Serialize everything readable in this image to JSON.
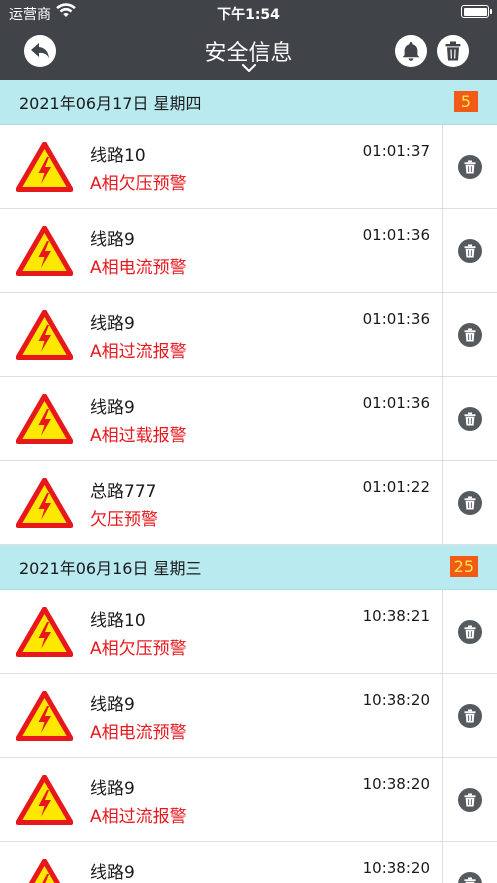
{
  "status_bar": {
    "carrier": "运营商",
    "time": "下午1:54"
  },
  "nav": {
    "title": "安全信息"
  },
  "icons": {
    "back": "back-arrow-icon",
    "bell": "bell-icon",
    "trash": "trash-icon",
    "warning": "high-voltage-warning-icon",
    "row_delete": "trash-icon"
  },
  "colors": {
    "nav_bg": "#404448",
    "day_header_bg": "#b9eaf0",
    "badge_bg": "#f25a18",
    "badge_text": "#ffe84a",
    "alarm_text": "#e8171c"
  },
  "days": [
    {
      "date": "2021年06月17日 星期四",
      "count": "5",
      "items": [
        {
          "line": "线路10",
          "alarm": "A相欠压预警",
          "time": "01:01:37"
        },
        {
          "line": "线路9",
          "alarm": "A相电流预警",
          "time": "01:01:36"
        },
        {
          "line": "线路9",
          "alarm": "A相过流报警",
          "time": "01:01:36"
        },
        {
          "line": "线路9",
          "alarm": "A相过载报警",
          "time": "01:01:36"
        },
        {
          "line": "总路777",
          "alarm": "欠压预警",
          "time": "01:01:22"
        }
      ]
    },
    {
      "date": "2021年06月16日 星期三",
      "count": "25",
      "items": [
        {
          "line": "线路10",
          "alarm": "A相欠压预警",
          "time": "10:38:21"
        },
        {
          "line": "线路9",
          "alarm": "A相电流预警",
          "time": "10:38:20"
        },
        {
          "line": "线路9",
          "alarm": "A相过流报警",
          "time": "10:38:20"
        },
        {
          "line": "线路9",
          "alarm": "",
          "time": "10:38:20"
        }
      ]
    }
  ]
}
